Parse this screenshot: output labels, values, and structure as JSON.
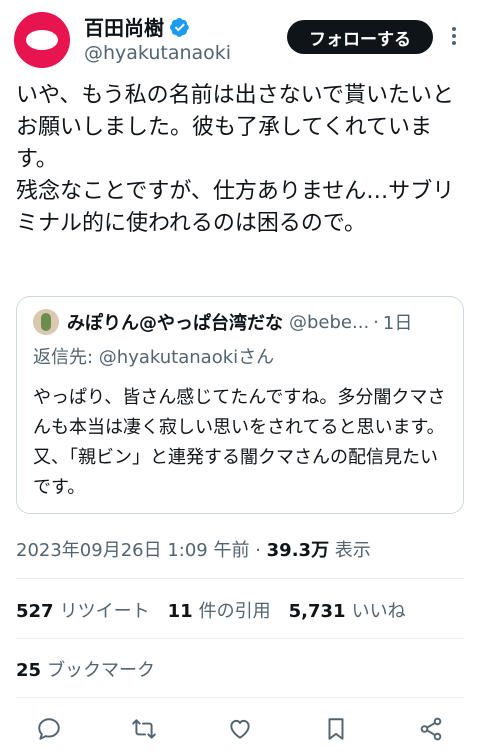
{
  "user": {
    "display_name": "百田尚樹",
    "handle": "@hyakutanaoki"
  },
  "follow_label": "フォローする",
  "tweet_text": "いや、もう私の名前は出さないで貰いたいとお願いしました。彼も了承してくれています。\n残念なことですが、仕方ありません…サブリミナル的に使われるのは困るので。",
  "quote": {
    "name": "みぽりん@やっぱ台湾だな",
    "handle": "@bebe...",
    "time": "1日",
    "reply_prefix": "返信先: ",
    "reply_mention": "@hyakutanaoki",
    "reply_suffix": "さん",
    "text": "やっぱり、皆さん感じてたんですね。多分闇クマさんも本当は凄く寂しい思いをされてると思います。又、「親ビン」と連発する闇クマさんの配信見たいです。"
  },
  "meta": {
    "timestamp": "2023年09月26日 1:09 午前",
    "separator": " · ",
    "views": "39.3万",
    "views_label": " 表示"
  },
  "stats": {
    "retweets": "527",
    "retweets_label": "リツイート",
    "quotes": "11",
    "quotes_label": "件の引用",
    "likes": "5,731",
    "likes_label": "いいね"
  },
  "bookmarks": {
    "count": "25",
    "label": "ブックマーク"
  },
  "icons": {
    "verified": "verified-badge-icon",
    "more": "more-vertical-icon",
    "reply": "reply-icon",
    "retweet": "retweet-icon",
    "like": "heart-icon",
    "bookmark": "bookmark-icon",
    "share": "share-icon"
  },
  "colors": {
    "accent_dark": "#0f1419",
    "secondary_text": "#536471",
    "verified_blue": "#1d9bf0",
    "avatar_red": "#e8144f"
  }
}
